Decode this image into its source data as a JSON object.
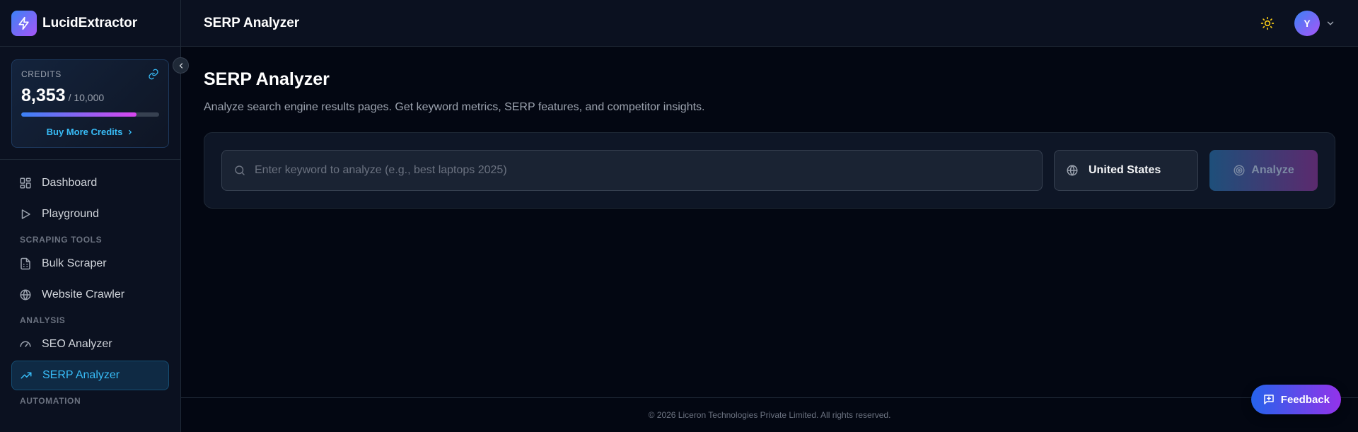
{
  "brand": {
    "name": "LucidExtractor",
    "icon": "bolt-icon"
  },
  "credits": {
    "title": "CREDITS",
    "used": "8,353",
    "total": "/ 10,000",
    "progress_fraction": 0.835,
    "buy_label": "Buy More Credits",
    "link_icon": "link-icon"
  },
  "sidebar": {
    "items_top": [
      {
        "label": "Dashboard",
        "icon": "grid-icon"
      },
      {
        "label": "Playground",
        "icon": "play-icon"
      }
    ],
    "section_scraping": "SCRAPING TOOLS",
    "items_scraping": [
      {
        "label": "Bulk Scraper",
        "icon": "file-icon"
      },
      {
        "label": "Website Crawler",
        "icon": "globe-icon"
      }
    ],
    "section_analysis": "ANALYSIS",
    "items_analysis": [
      {
        "label": "SEO Analyzer",
        "icon": "gauge-icon"
      },
      {
        "label": "SERP Analyzer",
        "icon": "trending-up-icon",
        "active": true
      }
    ],
    "section_automation": "AUTOMATION"
  },
  "header": {
    "title": "SERP Analyzer",
    "theme_icon": "sun-icon",
    "avatar_initial": "Y"
  },
  "main": {
    "title": "SERP Analyzer",
    "subtitle": "Analyze search engine results pages. Get keyword metrics, SERP features, and competitor insights.",
    "search": {
      "placeholder": "Enter keyword to analyze (e.g., best laptops 2025)",
      "value": ""
    },
    "country": "United States",
    "analyze_label": "Analyze"
  },
  "footer": {
    "text": "© 2026 Liceron Technologies Private Limited. All rights reserved."
  },
  "feedback": {
    "label": "Feedback"
  },
  "colors": {
    "background": "#030712",
    "sidebar": "#0b1120",
    "accent": "#38bdf8",
    "gradient_start": "#3b82f6",
    "gradient_end": "#a855f7"
  }
}
